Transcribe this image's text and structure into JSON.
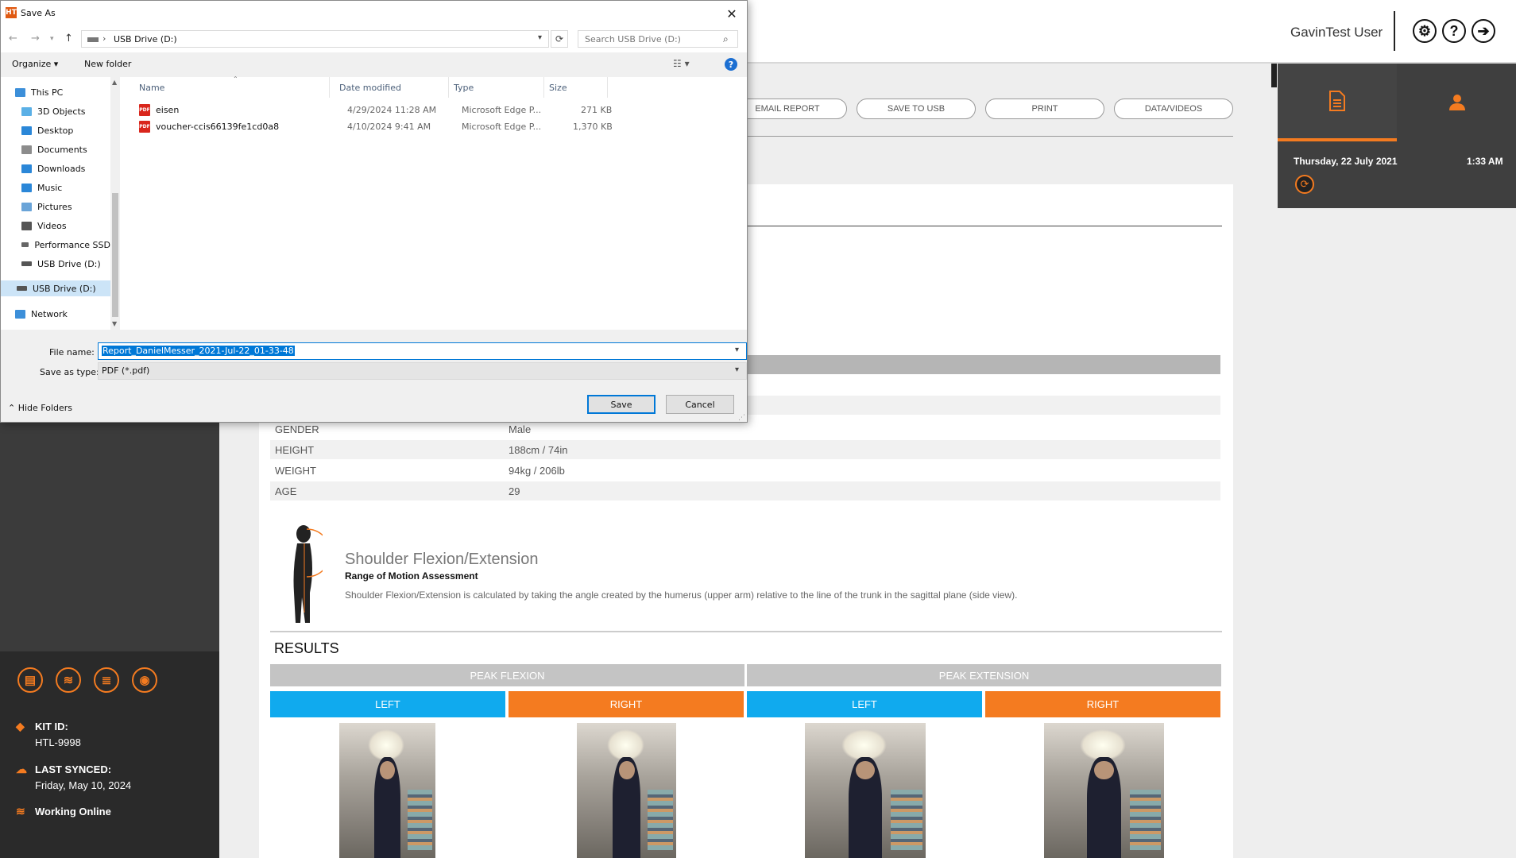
{
  "app": {
    "user_name": "GavinTest User",
    "topbar_icons": [
      "gear-icon",
      "help-icon",
      "logout-icon"
    ],
    "actions": [
      "EMAIL REPORT",
      "SAVE TO USB",
      "PRINT",
      "DATA/VIDEOS"
    ],
    "accent_color": "#f47b20",
    "left_side_color": "#10aaee",
    "right_panel": {
      "tabs": [
        "report-icon",
        "user-icon"
      ],
      "date": "Thursday, 22 July 2021",
      "time": "1:33 AM"
    },
    "left_panel": {
      "tool_icons": [
        "printer-icon",
        "wifi-icon",
        "database-icon",
        "camera-icon"
      ],
      "kit_id_label": "KIT ID:",
      "kit_id_value": "HTL-9998",
      "last_synced_label": "LAST SYNCED:",
      "last_synced_value": "Friday, May 10, 2024",
      "status": "Working Online"
    },
    "profile": [
      {
        "key": "GENDER",
        "value": "Male"
      },
      {
        "key": "HEIGHT",
        "value": "188cm / 74in"
      },
      {
        "key": "WEIGHT",
        "value": "94kg / 206lb"
      },
      {
        "key": "AGE",
        "value": "29"
      }
    ],
    "assessment": {
      "title": "Shoulder Flexion/Extension",
      "subtitle": "Range of Motion Assessment",
      "description": "Shoulder Flexion/Extension is calculated by taking the angle created by the humerus (upper arm) relative to the line of the trunk in the sagittal plane (side view)."
    },
    "results": {
      "heading": "RESULTS",
      "peak_flexion": "PEAK FLEXION",
      "peak_extension": "PEAK EXTENSION",
      "left": "LEFT",
      "right": "RIGHT"
    }
  },
  "dialog": {
    "title": "Save As",
    "app_icon_text": "HT",
    "address": {
      "location": "USB Drive (D:)",
      "separator": "›"
    },
    "search_placeholder": "Search USB Drive (D:)",
    "toolbar": {
      "organize": "Organize ▾",
      "new_folder": "New folder"
    },
    "nav_items": [
      {
        "label": "This PC",
        "icon": "pc-icon",
        "color": "#3c8fd9"
      },
      {
        "label": "3D Objects",
        "icon": "3d-objects-icon",
        "color": "#5bb0e6"
      },
      {
        "label": "Desktop",
        "icon": "desktop-icon",
        "color": "#2b87d8"
      },
      {
        "label": "Documents",
        "icon": "documents-icon",
        "color": "#8c8c8c"
      },
      {
        "label": "Downloads",
        "icon": "downloads-icon",
        "color": "#2b87d8"
      },
      {
        "label": "Music",
        "icon": "music-icon",
        "color": "#2b87d8"
      },
      {
        "label": "Pictures",
        "icon": "pictures-icon",
        "color": "#6aa4d8"
      },
      {
        "label": "Videos",
        "icon": "videos-icon",
        "color": "#555555"
      },
      {
        "label": "Performance SSD",
        "icon": "drive-icon",
        "color": "#666666"
      },
      {
        "label": "USB Drive (D:)",
        "icon": "usb-drive-icon",
        "color": "#555555"
      },
      {
        "label": "USB Drive (D:)",
        "icon": "usb-drive-icon",
        "color": "#555555",
        "selected": true
      },
      {
        "label": "Network",
        "icon": "network-icon",
        "color": "#3c8fd9"
      }
    ],
    "columns": [
      "Name",
      "Date modified",
      "Type",
      "Size"
    ],
    "files": [
      {
        "name": "eisen",
        "date": "4/29/2024 11:28 AM",
        "type": "Microsoft Edge P...",
        "size": "271 KB"
      },
      {
        "name": "voucher-ccis66139fe1cd0a8",
        "date": "4/10/2024 9:41 AM",
        "type": "Microsoft Edge P...",
        "size": "1,370 KB"
      }
    ],
    "file_name_label": "File name:",
    "file_name_value": "Report_DanielMesser_2021-Jul-22_01-33-48",
    "save_type_label": "Save as type:",
    "save_type_value": "PDF (*.pdf)",
    "hide_folders": "Hide Folders",
    "save": "Save",
    "cancel": "Cancel"
  }
}
